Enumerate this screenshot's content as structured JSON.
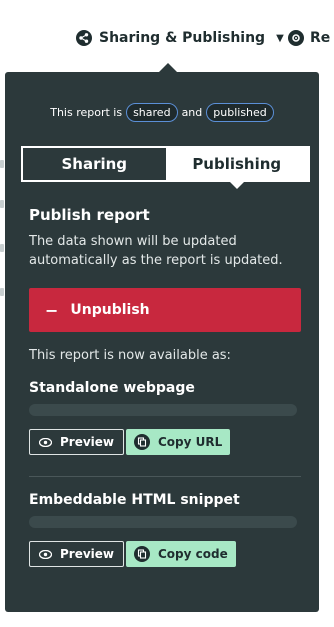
{
  "toolbar": {
    "sharing_menu_label": "Sharing & Publishing",
    "second_menu_label": "Re"
  },
  "panel": {
    "status_prefix": "This report is",
    "status_shared": "shared",
    "status_and": "and",
    "status_published": "published",
    "tabs": [
      {
        "label": "Sharing",
        "active": false
      },
      {
        "label": "Publishing",
        "active": true
      }
    ],
    "publish_title": "Publish report",
    "publish_desc": "The data shown will be updated automatically as the report is updated.",
    "unpublish_label": "Unpublish",
    "available_text": "This report is now available as:",
    "standalone": {
      "title": "Standalone webpage",
      "preview_label": "Preview",
      "copy_label": "Copy URL"
    },
    "embeddable": {
      "title": "Embeddable HTML snippet",
      "preview_label": "Preview",
      "copy_label": "Copy code"
    }
  },
  "colors": {
    "panel_bg": "#2c393b",
    "danger": "#c8283e",
    "success_bg": "#a7e8c5",
    "pill_border": "#5b8fd6"
  }
}
